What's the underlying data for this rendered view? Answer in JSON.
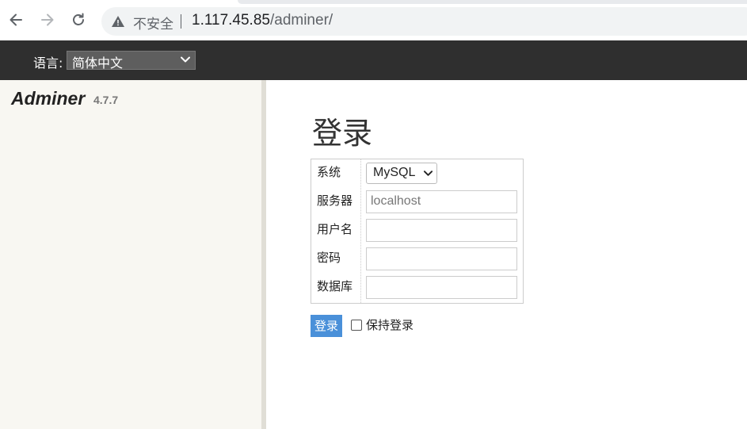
{
  "browser": {
    "security_label": "不安全",
    "url_host": "1.117.45.85",
    "url_path": "/adminer/"
  },
  "header": {
    "language_label": "语言:",
    "language_value": "简体中文"
  },
  "sidebar": {
    "brand": "Adminer",
    "version": "4.7.7"
  },
  "main": {
    "title": "登录",
    "fields": [
      {
        "label": "系统",
        "value": "MySQL"
      },
      {
        "label": "服务器",
        "value": "",
        "placeholder": "localhost"
      },
      {
        "label": "用户名",
        "value": ""
      },
      {
        "label": "密码",
        "value": ""
      },
      {
        "label": "数据库",
        "value": ""
      }
    ],
    "login_button": "登录",
    "remember_label": "保持登录",
    "remember_checked": false
  },
  "colors": {
    "header_bg": "#2f2f2f",
    "sidebar_bg": "#f8f7f2",
    "button_bg": "#4a90d9"
  }
}
